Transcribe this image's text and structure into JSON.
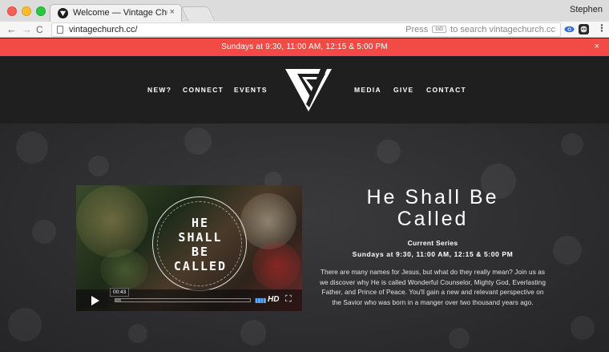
{
  "browser": {
    "tab_title": "Welcome — Vintage Church",
    "tab_close": "×",
    "profile_name": "Stephen",
    "url": "vintagechurch.cc/",
    "omnibox_hint_prefix": "Press",
    "omnibox_hint_key": "tab",
    "omnibox_hint_suffix": "to search vintagechurch.cc",
    "back": "←",
    "forward": "→",
    "reload": "C",
    "menu": "⋮"
  },
  "announcement": {
    "text": "Sundays at 9:30, 11:00 AM, 12:15 & 5:00 PM",
    "close": "×",
    "color": "#f24a45"
  },
  "nav": {
    "left": [
      "NEW?",
      "CONNECT",
      "EVENTS"
    ],
    "right": [
      "MEDIA",
      "GIVE",
      "CONTACT"
    ],
    "logo_icon": "vintage-church-logo-icon"
  },
  "video": {
    "artwork_lines": [
      "HE",
      "SHALL",
      "BE",
      "CALLED"
    ],
    "timecode": "00:43",
    "progress": 0.04,
    "hd_label": "HD",
    "fullscreen_icon": "fullscreen-icon"
  },
  "hero": {
    "title_line1": "He Shall Be",
    "title_line2": "Called",
    "series_label": "Current Series",
    "series_times": "Sundays at 9:30, 11:00 AM, 12:15 & 5:00 PM",
    "description": "There are many names for Jesus, but what do they really mean? Join us as we discover why He is called Wonderful Counselor, Mighty God, Everlasting Father, and Prince of Peace. You'll gain a new and relevant perspective on the Savior who was born in a manger over two thousand years ago."
  }
}
